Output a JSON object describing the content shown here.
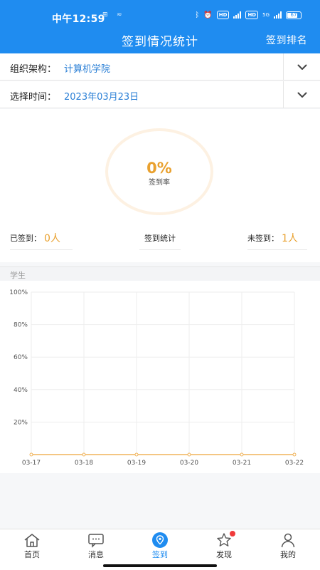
{
  "status_bar": {
    "time": "中午12:59",
    "battery": "67",
    "network": "5G"
  },
  "navbar": {
    "title": "签到情况统计",
    "rank_label": "签到排名"
  },
  "filters": {
    "org_label": "组织架构：",
    "org_value": "计算机学院",
    "time_label": "选择时间：",
    "time_value": "2023年03月23日"
  },
  "summary": {
    "rate": "0%",
    "rate_label": "签到率",
    "signed_label": "已签到：",
    "signed_value": "0人",
    "center_label": "签到统计",
    "unsigned_label": "未签到：",
    "unsigned_value": "1人"
  },
  "section": {
    "title": "学生"
  },
  "chart_data": {
    "type": "line",
    "x": [
      "03-17",
      "03-18",
      "03-19",
      "03-20",
      "03-21",
      "03-22"
    ],
    "yticks": [
      "20%",
      "40%",
      "60%",
      "80%",
      "100%"
    ],
    "ylim": [
      0,
      100
    ],
    "series": [
      {
        "values": [
          0,
          0,
          0,
          0,
          0,
          0
        ]
      }
    ],
    "color": "#f0b35a",
    "grid": true
  },
  "tabs": [
    {
      "label": "首页",
      "icon": "home-icon"
    },
    {
      "label": "消息",
      "icon": "message-icon"
    },
    {
      "label": "签到",
      "icon": "location-pin-icon",
      "active": true
    },
    {
      "label": "发现",
      "icon": "star-icon",
      "badge": true
    },
    {
      "label": "我的",
      "icon": "user-icon"
    }
  ],
  "colors": {
    "primary": "#1f8cf0",
    "accent": "#e9a12f",
    "link": "#2a7fd6"
  }
}
